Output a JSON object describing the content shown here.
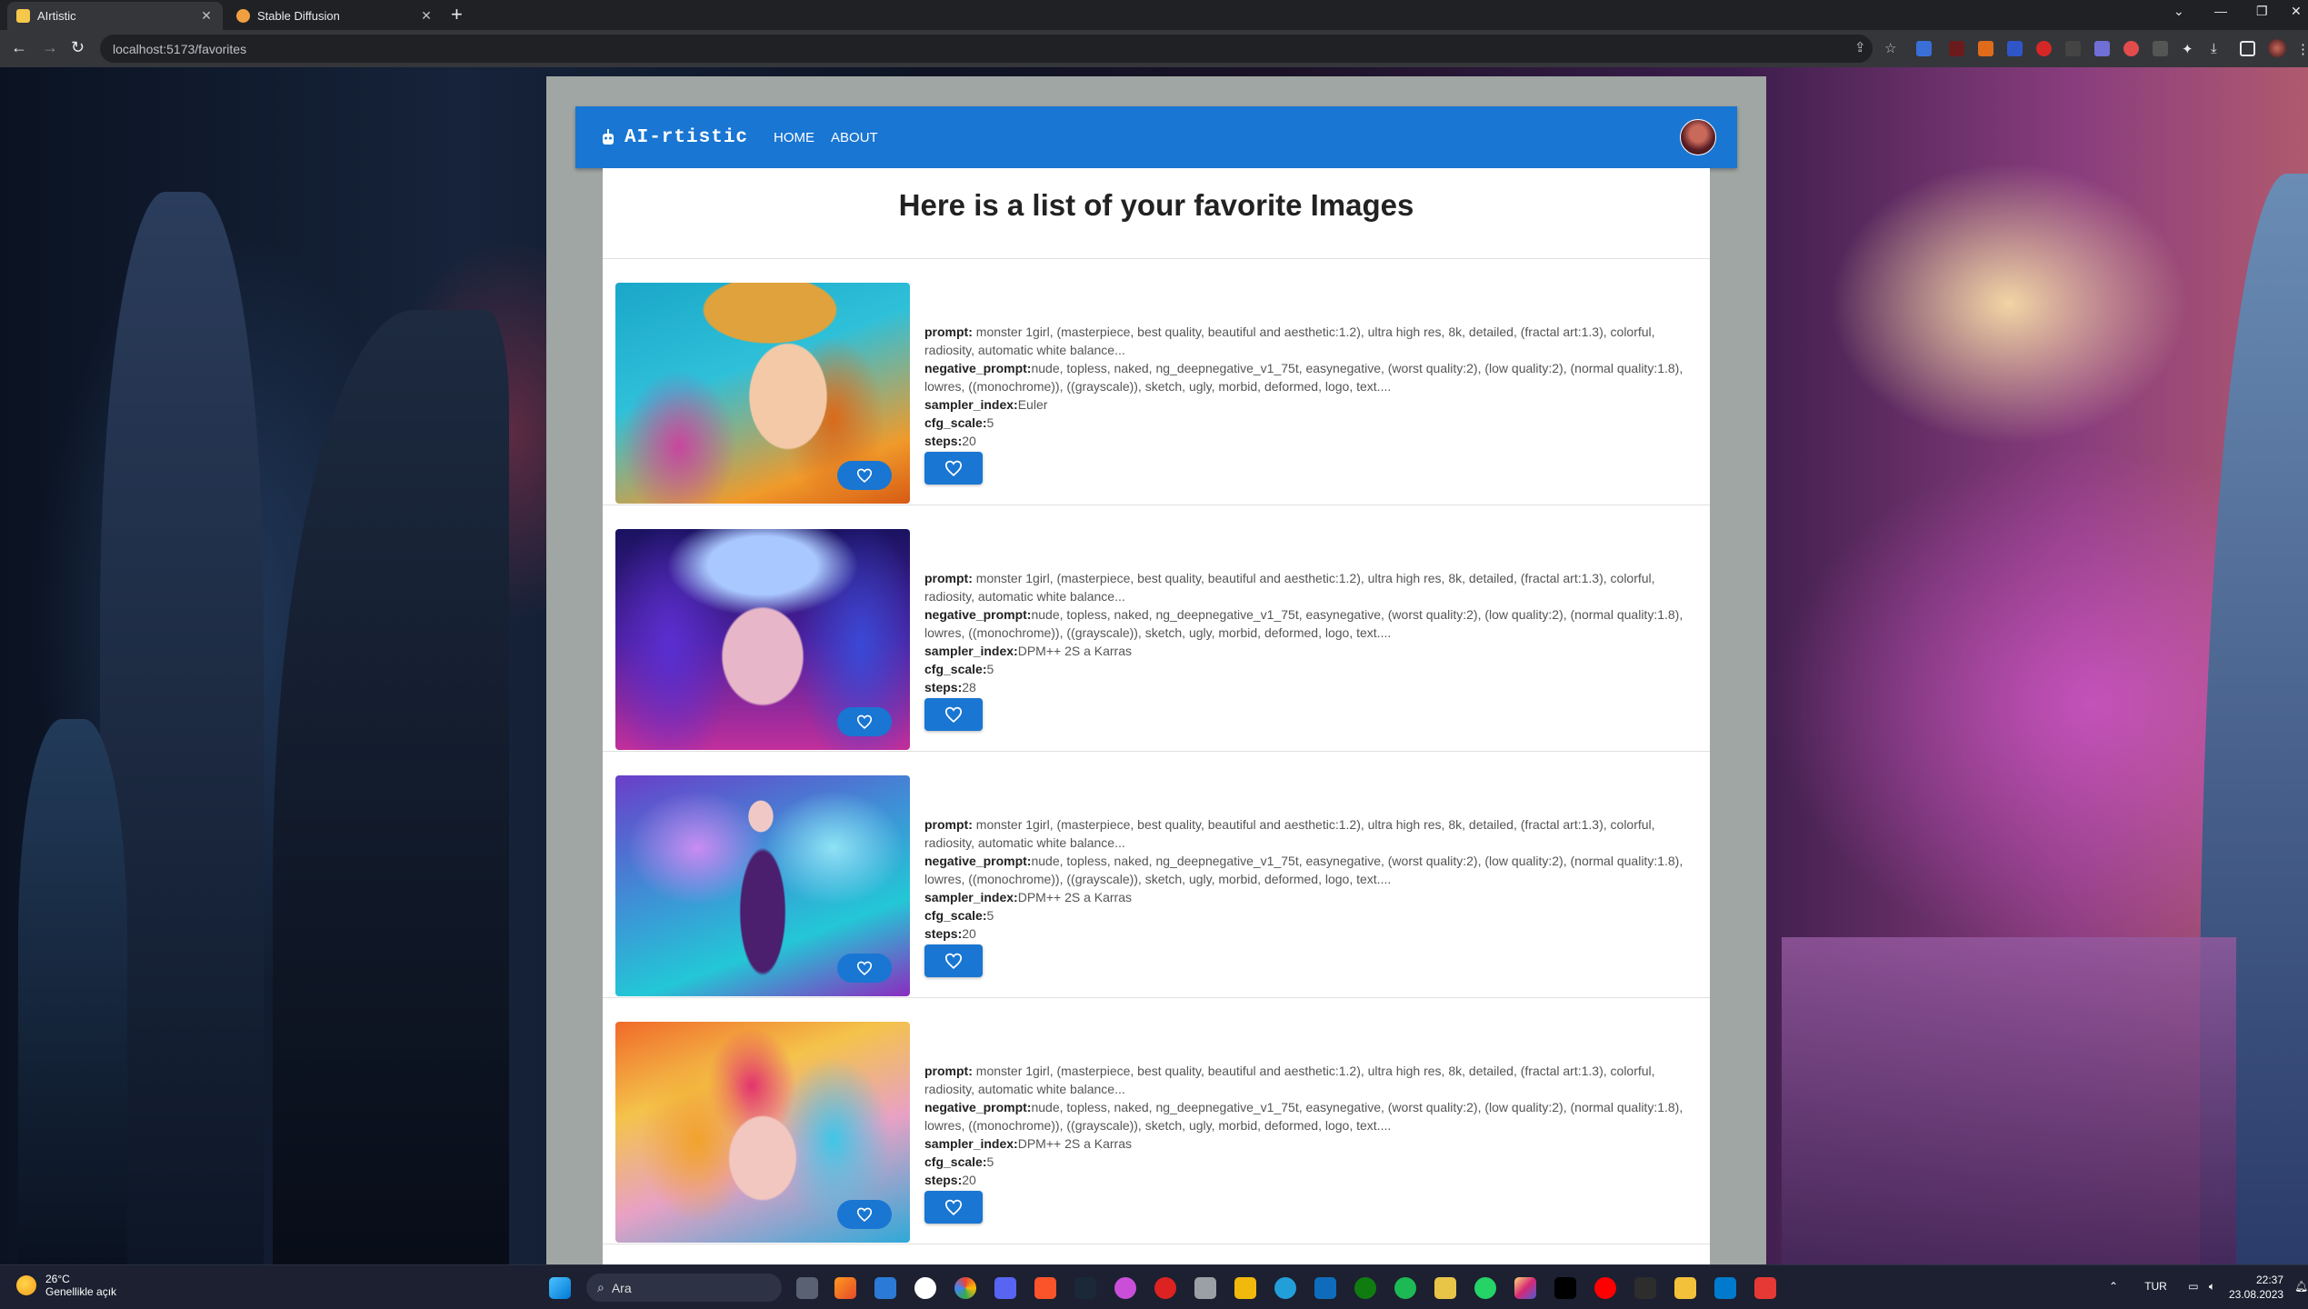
{
  "browser": {
    "tabs": [
      {
        "label": "AIrtistic",
        "favicon_color": "#f5c74b"
      },
      {
        "label": "Stable Diffusion",
        "favicon_color": "#f0a040"
      }
    ],
    "url": "localhost:5173/favorites"
  },
  "app": {
    "brand": "AI-rtistic",
    "nav": [
      "HOME",
      "ABOUT"
    ],
    "accent_color": "#1976d2"
  },
  "main": {
    "title": "Here is a list of your favorite Images",
    "items": [
      {
        "prompt_label": "prompt:",
        "prompt": " monster 1girl, (masterpiece, best quality, beautiful and aesthetic:1.2), ultra high res, 8k, detailed, (fractal art:1.3), colorful, radiosity, automatic white balance...",
        "neg_label": "negative_prompt:",
        "neg": "nude, topless, naked, ng_deepnegative_v1_75t, easynegative, (worst quality:2), (low quality:2), (normal quality:1.8), lowres, ((monochrome)), ((grayscale)), sketch, ugly, morbid, deformed, logo, text....",
        "sampler_label": "sampler_index:",
        "sampler": "Euler",
        "cfg_label": "cfg_scale:",
        "cfg": "5",
        "steps_label": "steps:",
        "steps": "20"
      },
      {
        "prompt_label": "prompt:",
        "prompt": " monster 1girl, (masterpiece, best quality, beautiful and aesthetic:1.2), ultra high res, 8k, detailed, (fractal art:1.3), colorful, radiosity, automatic white balance...",
        "neg_label": "negative_prompt:",
        "neg": "nude, topless, naked, ng_deepnegative_v1_75t, easynegative, (worst quality:2), (low quality:2), (normal quality:1.8), lowres, ((monochrome)), ((grayscale)), sketch, ugly, morbid, deformed, logo, text....",
        "sampler_label": "sampler_index:",
        "sampler": "DPM++ 2S a Karras",
        "cfg_label": "cfg_scale:",
        "cfg": "5",
        "steps_label": "steps:",
        "steps": "28"
      },
      {
        "prompt_label": "prompt:",
        "prompt": " monster 1girl, (masterpiece, best quality, beautiful and aesthetic:1.2), ultra high res, 8k, detailed, (fractal art:1.3), colorful, radiosity, automatic white balance...",
        "neg_label": "negative_prompt:",
        "neg": "nude, topless, naked, ng_deepnegative_v1_75t, easynegative, (worst quality:2), (low quality:2), (normal quality:1.8), lowres, ((monochrome)), ((grayscale)), sketch, ugly, morbid, deformed, logo, text....",
        "sampler_label": "sampler_index:",
        "sampler": "DPM++ 2S a Karras",
        "cfg_label": "cfg_scale:",
        "cfg": "5",
        "steps_label": "steps:",
        "steps": "20"
      },
      {
        "prompt_label": "prompt:",
        "prompt": " monster 1girl, (masterpiece, best quality, beautiful and aesthetic:1.2), ultra high res, 8k, detailed, (fractal art:1.3), colorful, radiosity, automatic white balance...",
        "neg_label": "negative_prompt:",
        "neg": "nude, topless, naked, ng_deepnegative_v1_75t, easynegative, (worst quality:2), (low quality:2), (normal quality:1.8), lowres, ((monochrome)), ((grayscale)), sketch, ugly, morbid, deformed, logo, text....",
        "sampler_label": "sampler_index:",
        "sampler": "DPM++ 2S a Karras",
        "cfg_label": "cfg_scale:",
        "cfg": "5",
        "steps_label": "steps:",
        "steps": "20"
      }
    ]
  },
  "taskbar": {
    "temperature": "26°C",
    "weather": "Genellikle açık",
    "search_placeholder": "Ara",
    "language": "TUR",
    "time": "22:37",
    "date": "23.08.2023"
  }
}
